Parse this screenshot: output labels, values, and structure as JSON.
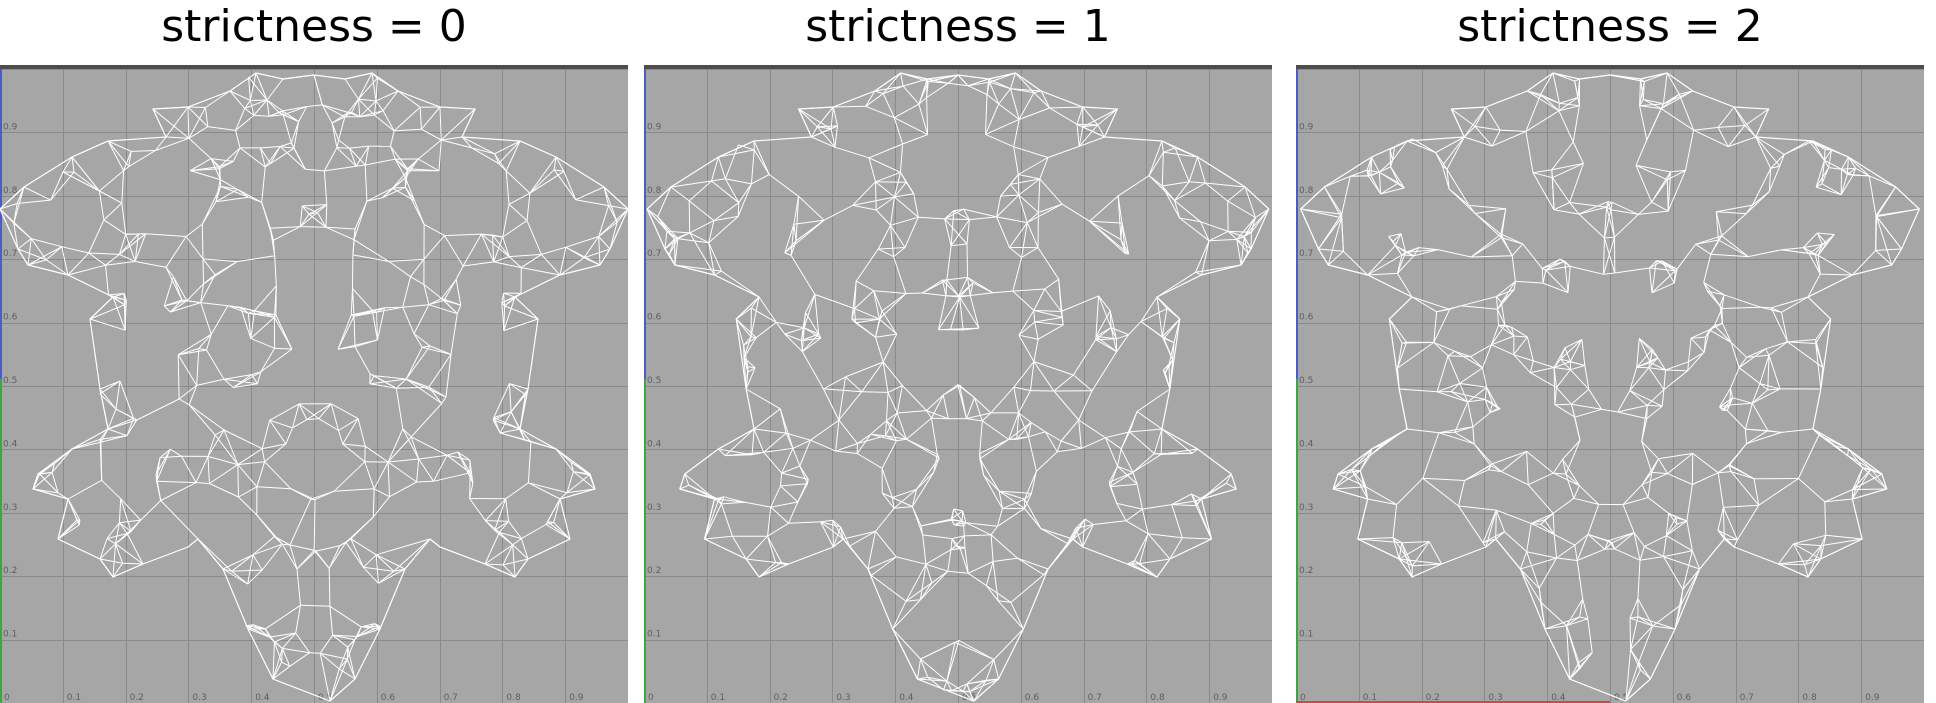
{
  "colors": {
    "viewport_bg": "#a6a6a6",
    "grid_line": "#8a8a8a",
    "mesh_edge": "#ffffff",
    "v_axis": "#4a5cc8",
    "u_axis": "#c84a4a",
    "green_axis": "#3fa63f"
  },
  "panels": [
    {
      "title": "strictness = 0",
      "u_ticks": [
        "0",
        "0.1",
        "0.2",
        "0.3",
        "0.4",
        "0.5",
        "0.6",
        "0.7",
        "0.8",
        "0.9"
      ],
      "v_ticks": [
        "0.1",
        "0.2",
        "0.3",
        "0.4",
        "0.5",
        "0.6",
        "0.7",
        "0.8",
        "0.9"
      ]
    },
    {
      "title": "strictness = 1",
      "u_ticks": [
        "0",
        "0.1",
        "0.2",
        "0.3",
        "0.4",
        "0.5",
        "0.6",
        "0.7",
        "0.8",
        "0.9"
      ],
      "v_ticks": [
        "0.1",
        "0.2",
        "0.3",
        "0.4",
        "0.5",
        "0.6",
        "0.7",
        "0.8",
        "0.9"
      ]
    },
    {
      "title": "strictness = 2",
      "u_ticks": [
        "0",
        "0.1",
        "0.2",
        "0.3",
        "0.4",
        "0.5",
        "0.6",
        "0.7",
        "0.8",
        "0.9"
      ],
      "v_ticks": [
        "0.1",
        "0.2",
        "0.3",
        "0.4",
        "0.5",
        "0.6",
        "0.7",
        "0.8",
        "0.9"
      ]
    }
  ]
}
